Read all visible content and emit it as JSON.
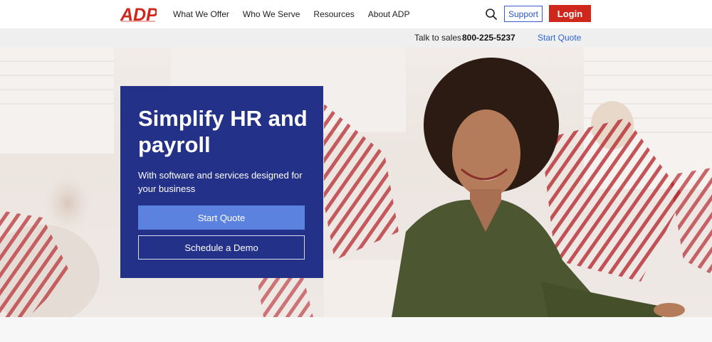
{
  "brand": {
    "logo_text": "ADP",
    "logo_color": "#d0271d"
  },
  "nav": {
    "items": [
      {
        "label": "What We Offer"
      },
      {
        "label": "Who We Serve"
      },
      {
        "label": "Resources"
      },
      {
        "label": "About ADP"
      }
    ],
    "support_label": "Support",
    "login_label": "Login"
  },
  "subbar": {
    "sales_label": "Talk to sales",
    "sales_phone": "800-225-5237",
    "start_quote_label": "Start Quote"
  },
  "hero": {
    "title": "Simplify HR and payroll",
    "subtitle": "With software and services designed for your business",
    "primary_cta": "Start Quote",
    "secondary_cta": "Schedule a Demo",
    "card_color": "#233189",
    "primary_cta_color": "#5b82de"
  },
  "colors": {
    "accent_red": "#d0271d",
    "link_blue": "#2f64d6"
  }
}
